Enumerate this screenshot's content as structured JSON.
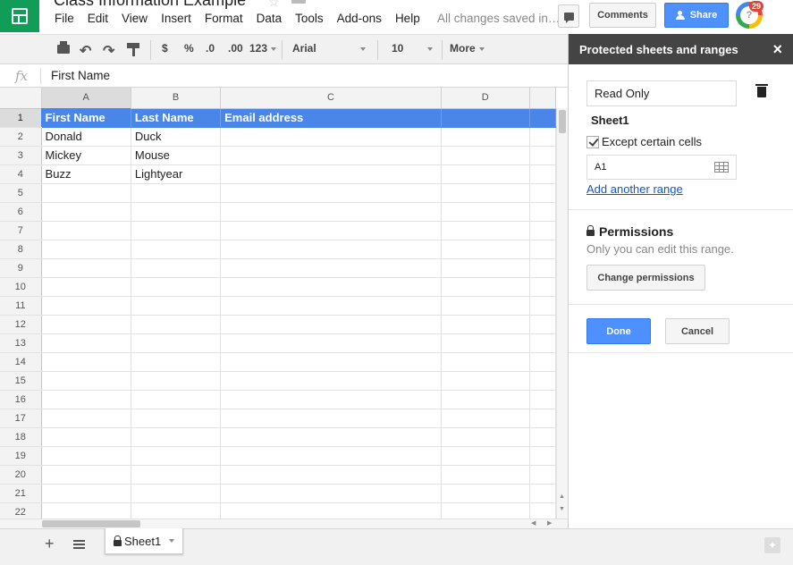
{
  "app": {
    "title": "Class Information Example",
    "menu": [
      "File",
      "Edit",
      "View",
      "Insert",
      "Format",
      "Data",
      "Tools",
      "Add-ons",
      "Help"
    ],
    "saved_status": "All changes saved in…",
    "comments_label": "Comments",
    "share_label": "Share",
    "notification_count": "29"
  },
  "toolbar": {
    "currency": "$",
    "percent": "%",
    "decrease_decimal": ".0",
    "increase_decimal": ".00",
    "number_format": "123",
    "font": "Arial",
    "font_size": "10",
    "more": "More"
  },
  "formula_bar": {
    "fx": "fx",
    "value": "First Name"
  },
  "grid": {
    "columns": [
      "A",
      "B",
      "C",
      "D"
    ],
    "row_numbers": [
      "1",
      "2",
      "3",
      "4",
      "5",
      "6",
      "7",
      "8",
      "9",
      "10",
      "11",
      "12",
      "13",
      "14",
      "15",
      "16",
      "17",
      "18",
      "19",
      "20",
      "21",
      "22"
    ],
    "header_row": [
      "First Name",
      "Last Name",
      "Email address",
      ""
    ],
    "rows": [
      [
        "Donald",
        "Duck",
        "",
        ""
      ],
      [
        "Mickey",
        "Mouse",
        "",
        ""
      ],
      [
        "Buzz",
        "Lightyear",
        "",
        ""
      ]
    ]
  },
  "sheet_tabs": {
    "active": "Sheet1"
  },
  "panel": {
    "title": "Protected sheets and ranges",
    "description_value": "Read Only",
    "sheet_name": "Sheet1",
    "except_label": "Except certain cells",
    "except_checked": true,
    "range_value": "A1",
    "add_range": "Add another range",
    "permissions_title": "Permissions",
    "permissions_desc": "Only you can edit this range.",
    "change_permissions": "Change permissions",
    "done": "Done",
    "cancel": "Cancel"
  },
  "colors": {
    "header_fill": "#4a86e8",
    "accent_blue": "#4d90fe",
    "sheets_green": "#0f9d58",
    "panel_head": "#444444"
  }
}
